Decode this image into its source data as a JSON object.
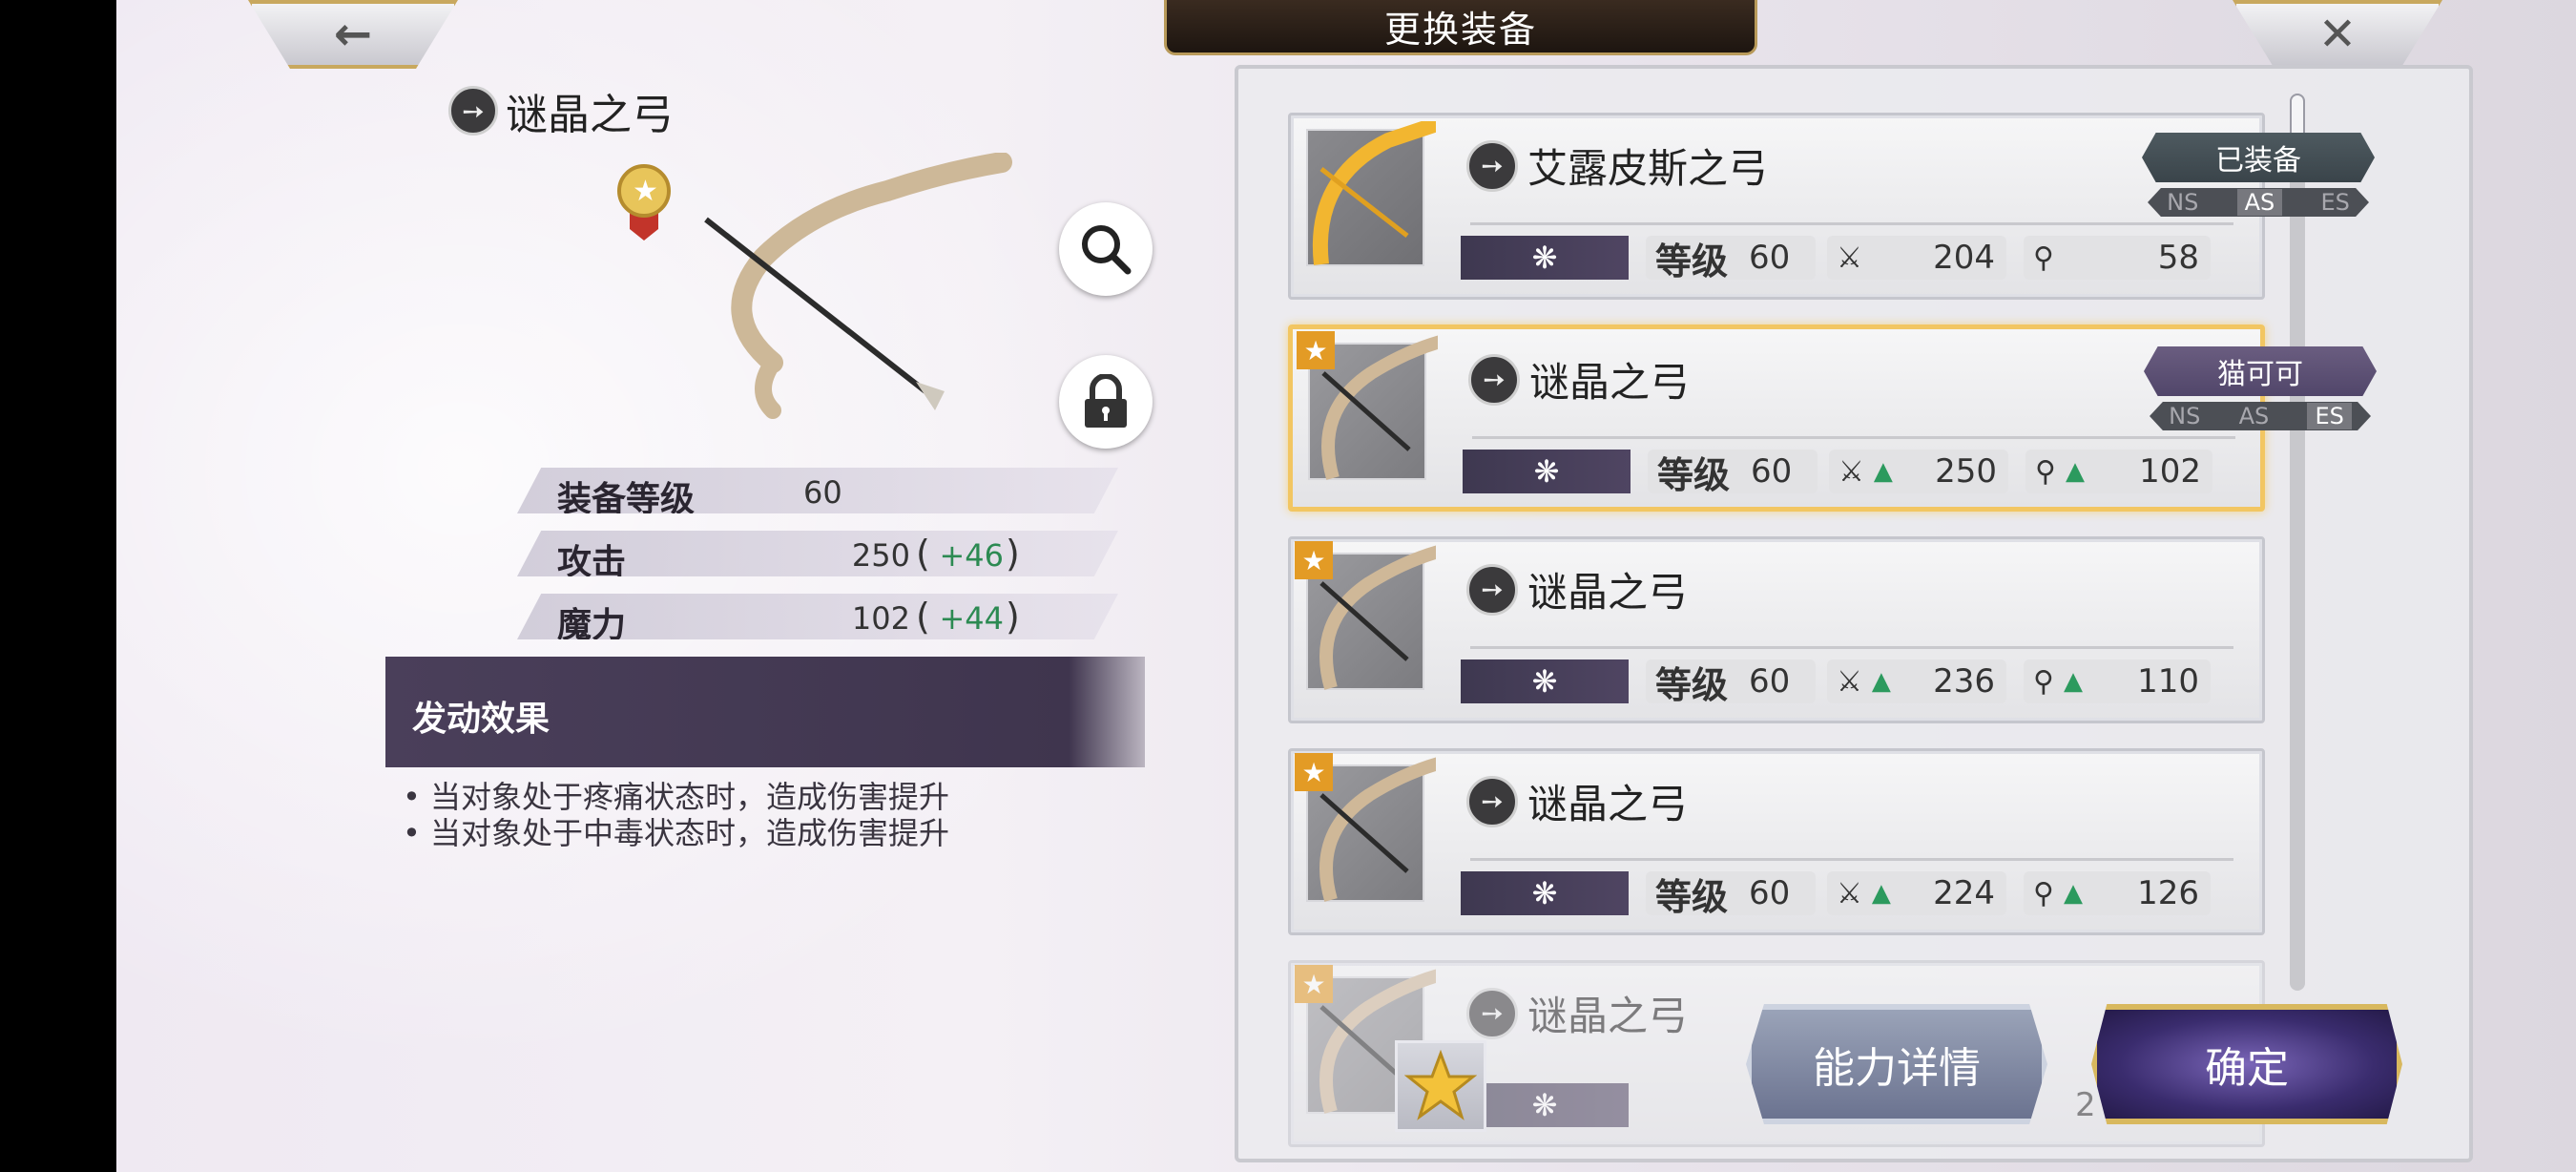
{
  "header": {
    "title": "更换装备",
    "back_icon": "arrow-left-icon",
    "close_icon": "close-icon"
  },
  "selected_item": {
    "name": "谜晶之弓",
    "stats": [
      {
        "label": "装备等级",
        "value": "60",
        "bonus": ""
      },
      {
        "label": "攻击",
        "value": "250",
        "bonus": "+46"
      },
      {
        "label": "魔力",
        "value": "102",
        "bonus": "+44"
      }
    ],
    "effect_title": "发动效果",
    "effects": [
      "• 当对象处于疼痛状态时，造成伤害提升",
      "• 当对象处于中毒状态时，造成伤害提升"
    ]
  },
  "list": {
    "cards": [
      {
        "name": "艾露皮斯之弓",
        "tag": "已装备",
        "modes": [
          "NS",
          "AS",
          "ES"
        ],
        "active_mode": "AS",
        "level_label": "等级",
        "level": "60",
        "atk": "204",
        "mag": "58",
        "atk_up": false,
        "mag_up": false
      },
      {
        "name": "谜晶之弓",
        "tag": "猫可可",
        "modes": [
          "NS",
          "AS",
          "ES"
        ],
        "active_mode": "ES",
        "level_label": "等级",
        "level": "60",
        "atk": "250",
        "mag": "102",
        "atk_up": true,
        "mag_up": true
      },
      {
        "name": "谜晶之弓",
        "tag": "",
        "level_label": "等级",
        "level": "60",
        "atk": "236",
        "mag": "110",
        "atk_up": true,
        "mag_up": true
      },
      {
        "name": "谜晶之弓",
        "tag": "",
        "level_label": "等级",
        "level": "60",
        "atk": "224",
        "mag": "126",
        "atk_up": true,
        "mag_up": true
      },
      {
        "name": "谜晶之弓",
        "tag": "",
        "partial": "2"
      }
    ]
  },
  "buttons": {
    "details": "能力详情",
    "confirm": "确定",
    "favorite_icon": "star-icon"
  },
  "colors": {
    "accent_gold": "#d8b85e",
    "bonus_green": "#2c8a52",
    "up_arrow": "#2c9a5e",
    "banner": "#4a3f5a"
  }
}
